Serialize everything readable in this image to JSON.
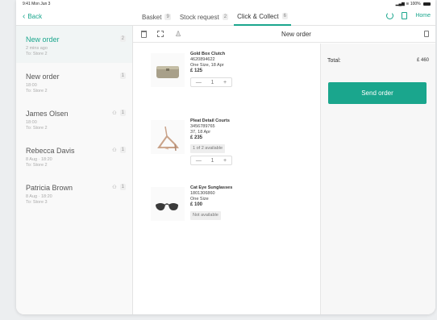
{
  "status_bar": {
    "time": "9:41 Mon Jun 3",
    "battery": "100%"
  },
  "nav": {
    "back_label": "Back",
    "tabs": [
      {
        "label": "Basket",
        "count": "9"
      },
      {
        "label": "Stock request",
        "count": "2"
      },
      {
        "label": "Click & Collect",
        "count": "6"
      }
    ],
    "home_label": "Home"
  },
  "orders": [
    {
      "name": "New order",
      "time": "2 mins ago",
      "store": "To: Store 2",
      "count": "2",
      "person": ""
    },
    {
      "name": "New order",
      "time": "18:00",
      "store": "To: Store 2",
      "count": "1",
      "person": ""
    },
    {
      "name": "James Olsen",
      "time": "18:00",
      "store": "To: Store 2",
      "count": "1",
      "person": "⚇"
    },
    {
      "name": "Rebecca Davis",
      "time": "8 Aug · 18:20",
      "store": "To: Store 2",
      "count": "1",
      "person": "⚇"
    },
    {
      "name": "Patricia Brown",
      "time": "8 Aug · 18:20",
      "store": "To: Store 3",
      "count": "1",
      "person": "⚇"
    }
  ],
  "toolbar": {
    "title": "New order"
  },
  "items": [
    {
      "name": "Gold Box Clutch",
      "sku": "4620894622",
      "variant": "One Size, 18 Apr",
      "price": "£ 125",
      "qty": "1",
      "minus": "—",
      "plus": "+"
    },
    {
      "name": "Pleat Detail Courts",
      "sku": "3456789765",
      "variant": "37, 18 Apr",
      "price": "£ 235",
      "chip": "1 of 2 available",
      "qty": "1",
      "minus": "—",
      "plus": "+"
    },
    {
      "name": "Cat Eye Sunglasses",
      "sku": "1801306860",
      "variant": "One Size",
      "price": "£ 100",
      "chip": "Not available"
    }
  ],
  "summary": {
    "total_label": "Total:",
    "total_value": "£ 460",
    "send_label": "Send order"
  },
  "colors": {
    "accent": "#1aa68d"
  }
}
